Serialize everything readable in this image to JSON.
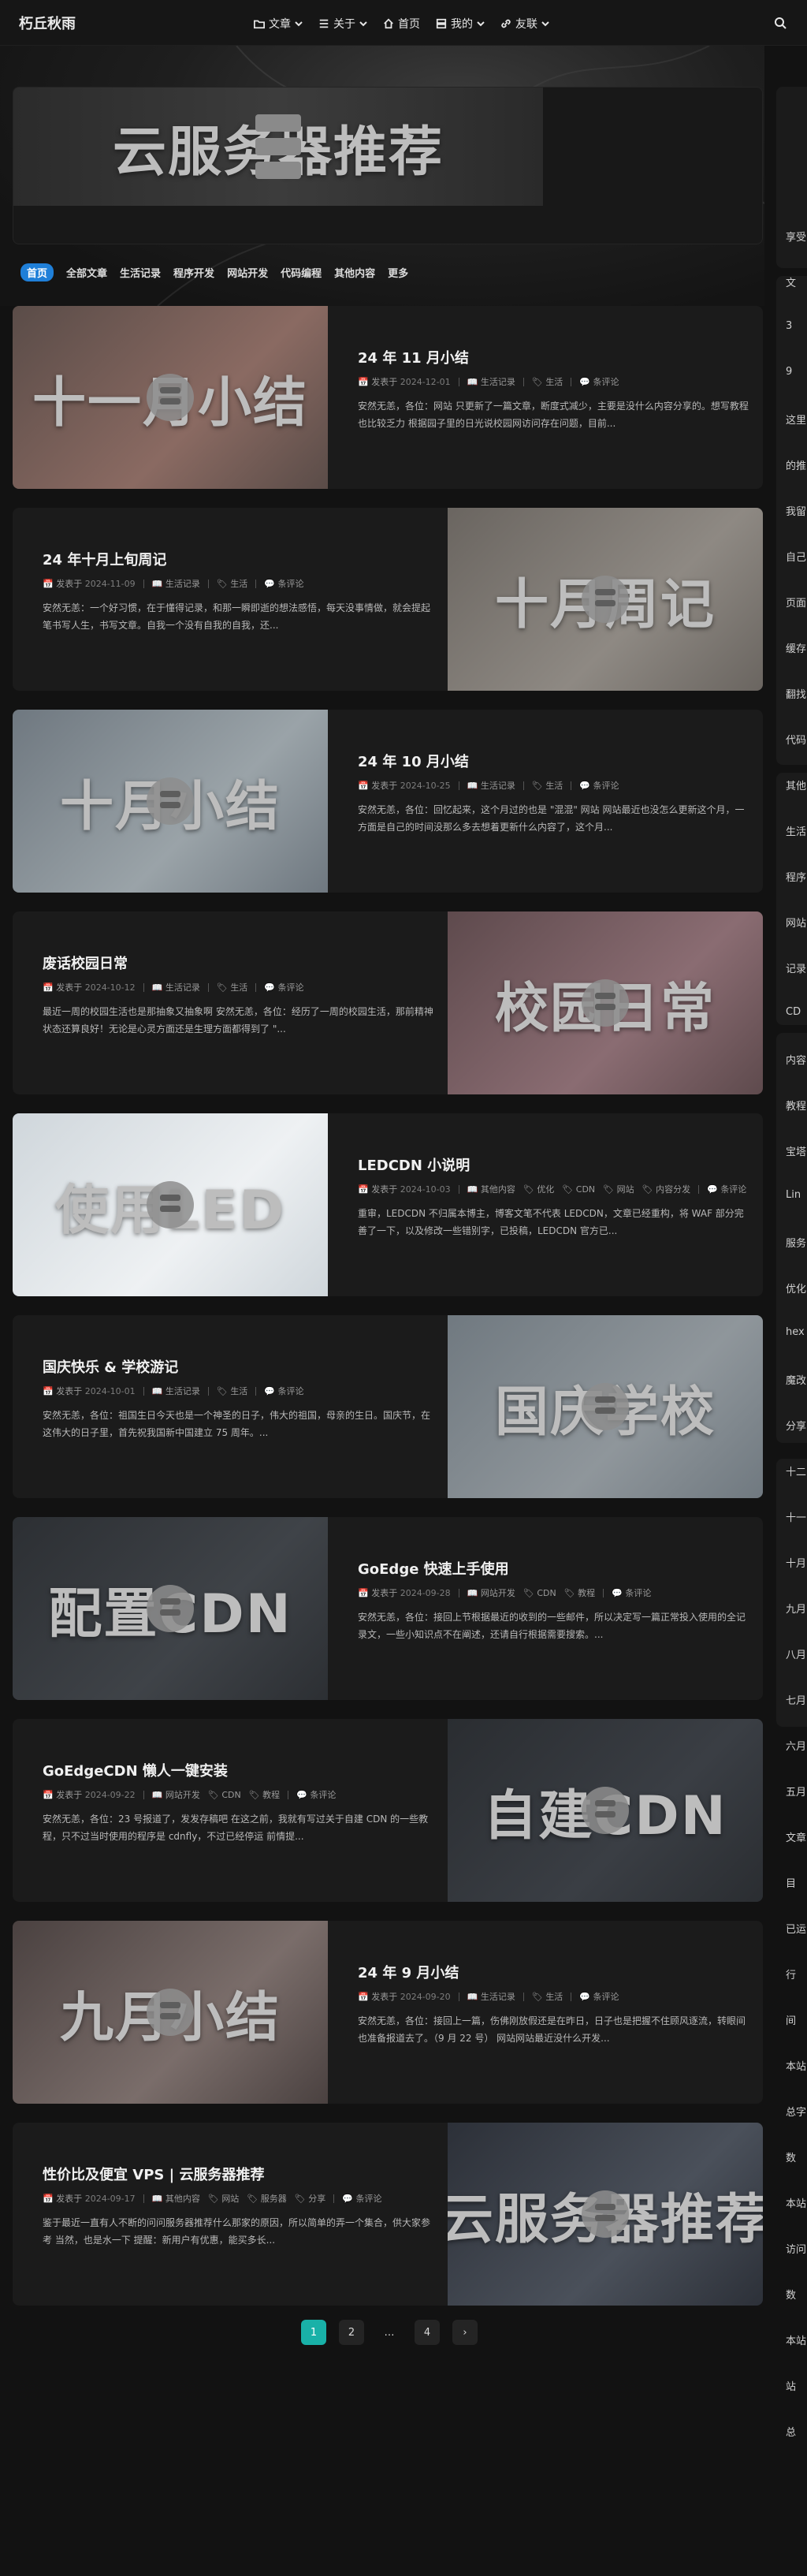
{
  "site": {
    "brand": "朽丘秋雨"
  },
  "nav": {
    "menu": [
      {
        "label": "文章",
        "icon": "folder-icon",
        "dropdown": true
      },
      {
        "label": "关于",
        "icon": "list-icon",
        "dropdown": true
      },
      {
        "label": "首页",
        "icon": "home-icon",
        "dropdown": false
      },
      {
        "label": "我的",
        "icon": "server-icon",
        "dropdown": true
      },
      {
        "label": "友联",
        "icon": "link-icon",
        "dropdown": true
      }
    ],
    "search_icon": "search-icon"
  },
  "banner": {
    "text": "云服务器推荐"
  },
  "categories": [
    "首页",
    "全部文章",
    "生活记录",
    "程序开发",
    "网站开发",
    "代码编程",
    "其他内容",
    "更多"
  ],
  "posts": [
    {
      "title": "24 年 11 月小结",
      "thumb_text": "十一月小结",
      "date_label": "发表于",
      "date": "2024-12-01",
      "cat1": "生活记录",
      "cat2": "生活",
      "comments": "条评论",
      "excerpt": "安然无恙，各位：网站 只更新了一篇文章，断度式减少，主要是没什么内容分享的。想写教程也比较乏力 根据园子里的日光说校园网访问存在问题，目前..."
    },
    {
      "title": "24 年十月上旬周记",
      "thumb_text": "十月周记",
      "date_label": "发表于",
      "date": "2024-11-09",
      "cat1": "生活记录",
      "cat2": "生活",
      "comments": "条评论",
      "excerpt": "安然无恙：一个好习惯，在于懂得记录，和那一瞬即逝的想法感悟，每天没事情做，就会提起笔书写人生，书写文章。自我一个没有自我的自我，还..."
    },
    {
      "title": "24 年 10 月小结",
      "thumb_text": "十月小结",
      "date_label": "发表于",
      "date": "2024-10-25",
      "cat1": "生活记录",
      "cat2": "生活",
      "comments": "条评论",
      "excerpt": "安然无恙，各位：回忆起来，这个月过的也是 \"混混\" 网站 网站最近也没怎么更新这个月，一方面是自己的时间没那么多去想着更新什么内容了，这个月..."
    },
    {
      "title": "废话校园日常",
      "thumb_text": "校园日常",
      "date_label": "发表于",
      "date": "2024-10-12",
      "cat1": "生活记录",
      "cat2": "生活",
      "comments": "条评论",
      "excerpt": "最近一周的校园生活也是那抽象又抽象啊 安然无恙，各位：经历了一周的校园生活，那前精神状态还算良好！无论是心灵方面还是生理方面都得到了 \"..."
    },
    {
      "title": "LEDCDN 小说明",
      "thumb_text": "使用LED",
      "date_label": "发表于",
      "date": "2024-10-03",
      "cat1": "其他内容",
      "tags": [
        "优化",
        "CDN",
        "网站",
        "内容分发"
      ],
      "comments": "条评论",
      "excerpt": "重审，LEDCDN 不归属本博主，博客文笔不代表 LEDCDN，文章已经重构，将 WAF 部分完善了一下，以及修改一些错别字，已投稿，LEDCDN 官方已..."
    },
    {
      "title": "国庆快乐 & 学校游记",
      "thumb_text": "国庆学校",
      "date_label": "发表于",
      "date": "2024-10-01",
      "cat1": "生活记录",
      "cat2": "生活",
      "comments": "条评论",
      "excerpt": "安然无恙，各位：祖国生日今天也是一个神圣的日子，伟大的祖国，母亲的生日。国庆节，在这伟大的日子里，首先祝我国新中国建立 75 周年。..."
    },
    {
      "title": "GoEdge 快速上手使用",
      "thumb_text": "配置CDN",
      "date_label": "发表于",
      "date": "2024-09-28",
      "cat1": "网站开发",
      "tags": [
        "CDN",
        "教程"
      ],
      "comments": "条评论",
      "excerpt": "安然无恙，各位：接回上节根据最近的收到的一些邮件，所以决定写一篇正常投入使用的全记录文，一些小知识点不在阐述，还请自行根据需要搜索。..."
    },
    {
      "title": "GoEdgeCDN 懒人一键安装",
      "thumb_text": "自建CDN",
      "date_label": "发表于",
      "date": "2024-09-22",
      "cat1": "网站开发",
      "tags": [
        "CDN",
        "教程"
      ],
      "comments": "条评论",
      "excerpt": "安然无恙，各位：23 号报道了，发发存稿吧 在这之前，我就有写过关于自建 CDN 的一些教程，只不过当时使用的程序是 cdnfly，不过已经停运 前情提..."
    },
    {
      "title": "24 年 9 月小结",
      "thumb_text": "九月小结",
      "date_label": "发表于",
      "date": "2024-09-20",
      "cat1": "生活记录",
      "cat2": "生活",
      "comments": "条评论",
      "excerpt": "安然无恙，各位：接回上一篇，伤佛刚放假还是在昨日，日子也是把握不住顾风逐流，转眼间也准备报道去了。（9 月 22 号） 网站网站最近没什么开发..."
    },
    {
      "title": "性价比及便宜 VPS | 云服务器推荐",
      "thumb_text": "云服务器推荐",
      "date_label": "发表于",
      "date": "2024-09-17",
      "cat1": "其他内容",
      "tags": [
        "网站",
        "服务器",
        "分享"
      ],
      "comments": "条评论",
      "excerpt": "鉴于最近一直有人不断的问问服务器推荐什么那家的原因，所以简单的弄一个集合，供大家参考 当然，也是水一下 提醒：新用户有优惠，能买多长..."
    }
  ],
  "pagination": {
    "pages": [
      "1",
      "2",
      "…",
      "4"
    ],
    "current": "1",
    "next": "›"
  },
  "sidebar_fragments": [
    "享受",
    "文",
    "3",
    "9",
    "这里",
    "的推",
    "我留",
    "自己",
    "页面",
    "缓存",
    "翻找",
    "代码",
    "其他",
    "生活",
    "程序",
    "网站",
    "记录",
    "CD",
    "内容",
    "教程",
    "宝塔",
    "Lin",
    "服务",
    "优化",
    "hex",
    "魔改",
    "分享",
    "十二",
    "十一",
    "十月",
    "九月",
    "八月",
    "七月",
    "六月",
    "五月",
    "文章",
    "目",
    "已运",
    "行",
    "间",
    "本站",
    "总字",
    "数",
    "本站",
    "访问",
    "数",
    "本站",
    "站",
    "总"
  ]
}
